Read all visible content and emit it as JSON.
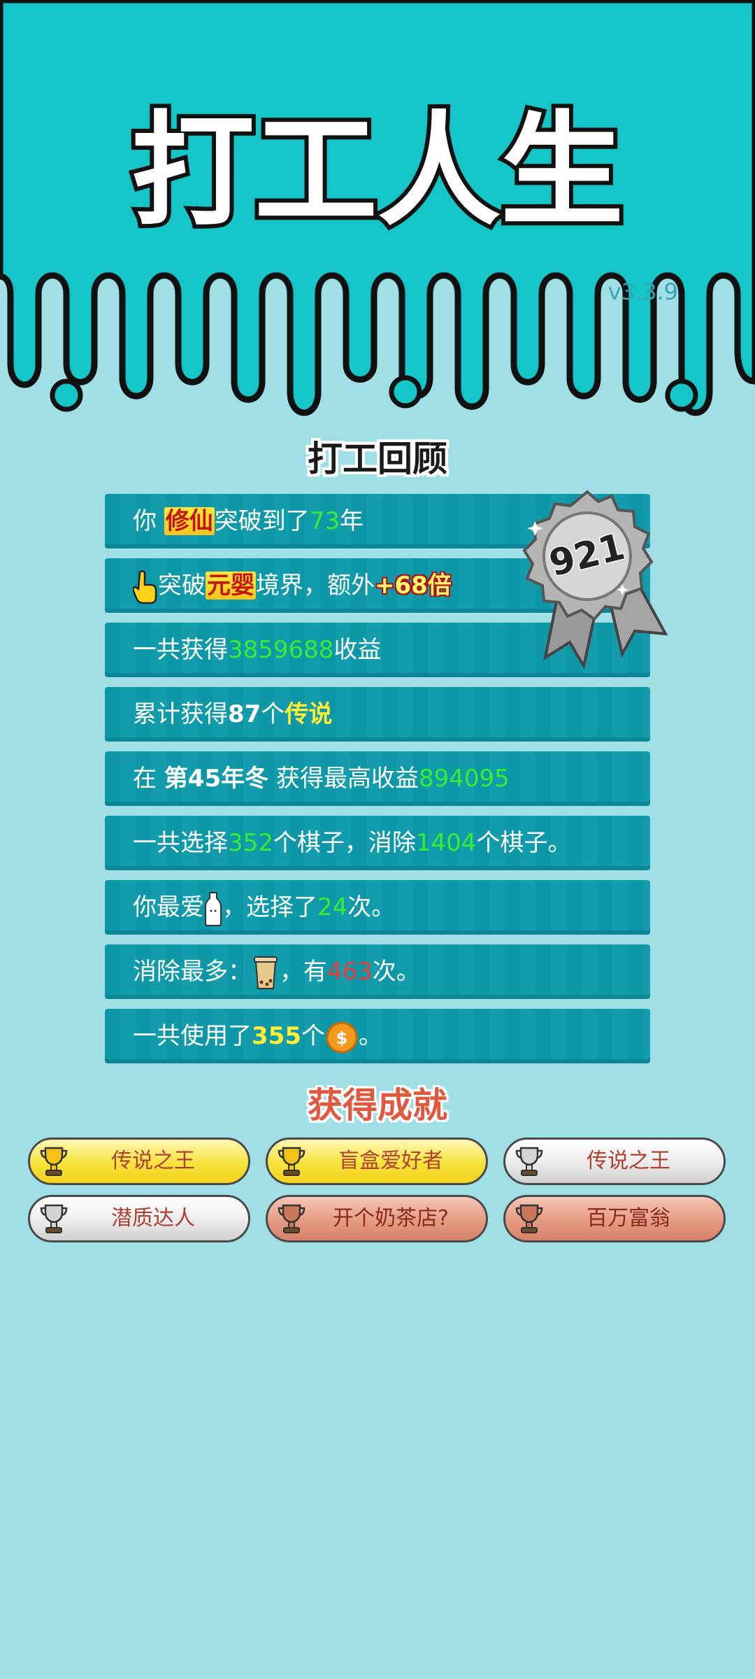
{
  "header": {
    "title": "打工人生",
    "version": "v3.3.9",
    "colors": {
      "top_band": "#15c6c8",
      "background": "#a0dfe6"
    }
  },
  "review": {
    "title": "打工回顾",
    "medal_number": "921",
    "rows": [
      {
        "parts": [
          "你 ",
          "修仙",
          "突破到了",
          "73",
          "年"
        ]
      },
      {
        "parts": [
          "突破",
          "元婴",
          "境界，额外",
          "+68倍"
        ],
        "icon": "pointing-hand-icon"
      },
      {
        "parts": [
          "一共获得",
          "3859688",
          "收益"
        ]
      },
      {
        "parts": [
          "累计获得",
          "87",
          "个",
          "传说"
        ]
      },
      {
        "parts": [
          "在 ",
          "第45年冬",
          " 获得最高收益",
          "894095"
        ]
      },
      {
        "parts": [
          "一共选择",
          "352",
          "个棋子，消除",
          "1404",
          "个棋子。"
        ]
      },
      {
        "parts": [
          "你最爱",
          "，选择了",
          "24",
          "次。"
        ],
        "icon": "milk-bottle-icon"
      },
      {
        "parts": [
          "消除最多：",
          "，有",
          "463",
          "次。"
        ],
        "icon": "bubble-tea-cup-icon"
      },
      {
        "parts": [
          "一共使用了",
          "355",
          "个",
          "。"
        ],
        "icon": "coin-icon"
      }
    ]
  },
  "achievements": {
    "title": "获得成就",
    "items": [
      {
        "label": "传说之王",
        "tier": "gold"
      },
      {
        "label": "盲盒爱好者",
        "tier": "gold"
      },
      {
        "label": "传说之王",
        "tier": "silver"
      },
      {
        "label": "潜质达人",
        "tier": "silver"
      },
      {
        "label": "开个奶茶店?",
        "tier": "bronze"
      },
      {
        "label": "百万富翁",
        "tier": "bronze"
      }
    ]
  }
}
